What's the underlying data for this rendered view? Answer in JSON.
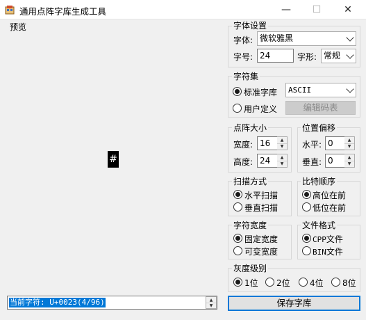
{
  "window": {
    "title": "通用点阵字库生成工具",
    "minimize_glyph": "—",
    "maximize_glyph": "☐",
    "close_glyph": "✕"
  },
  "preview": {
    "label": "预览",
    "glyph": "#",
    "status": "当前字符: U+0023(4/96)"
  },
  "font_settings": {
    "title": "字体设置",
    "font_label": "字体:",
    "font_value": "微软雅黑",
    "size_label": "字号:",
    "size_value": "24",
    "shape_label": "字形:",
    "shape_value": "常规"
  },
  "charset": {
    "title": "字符集",
    "standard_label": "标准字库",
    "standard_value": "ASCII",
    "custom_label": "用户定义",
    "edit_button": "编辑码表"
  },
  "matrix_size": {
    "title": "点阵大小",
    "width_label": "宽度:",
    "width_value": "16",
    "height_label": "高度:",
    "height_value": "24"
  },
  "offset": {
    "title": "位置偏移",
    "h_label": "水平:",
    "h_value": "0",
    "v_label": "垂直:",
    "v_value": "0"
  },
  "scan": {
    "title": "扫描方式",
    "horizontal": "水平扫描",
    "vertical": "垂直扫描"
  },
  "bit_order": {
    "title": "比特顺序",
    "msb": "高位在前",
    "lsb": "低位在前"
  },
  "char_width": {
    "title": "字符宽度",
    "fixed": "固定宽度",
    "variable": "可变宽度"
  },
  "file_format": {
    "title": "文件格式",
    "cpp": "CPP文件",
    "bin": "BIN文件"
  },
  "gray": {
    "title": "灰度级别",
    "l1": "1位",
    "l2": "2位",
    "l4": "4位",
    "l8": "8位"
  },
  "save_button": "保存字库",
  "colors": {
    "accent": "#0078d7",
    "window_bg": "#f0f0f0"
  }
}
